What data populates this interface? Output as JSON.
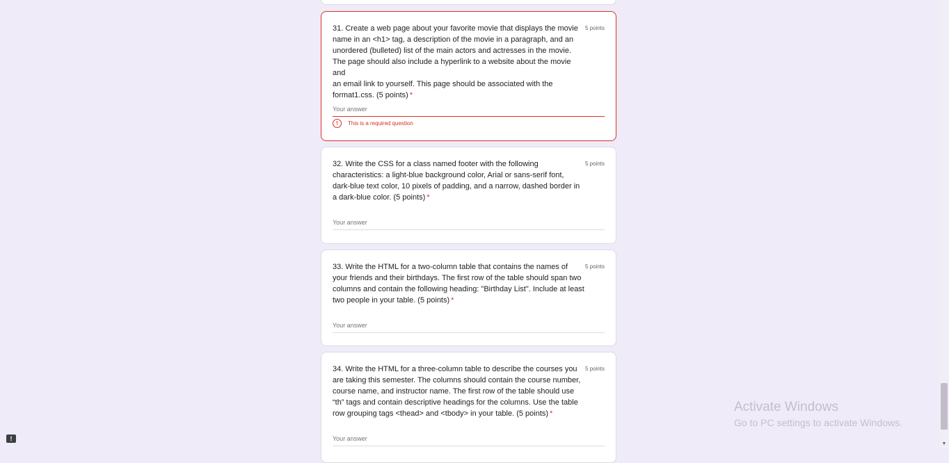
{
  "questions": [
    {
      "text": "31. Create a web page about your favorite movie that displays the movie\nname in an <h1> tag, a description of the movie in a paragraph, and an\nunordered (bulleted) list of the main actors and actresses in the movie.\nThe page should also include a hyperlink to a website about the movie and\nan email link to yourself. This page should be associated with the\nformat1.css. (5 points)",
      "required": "*",
      "points": "5 points",
      "placeholder": "Your answer",
      "error": "This is a required question"
    },
    {
      "text": "32. Write the CSS for a class named footer with the following\ncharacteristics: a light-blue background color, Arial or sans-serif font,\ndark-blue text color, 10 pixels of padding, and a narrow, dashed border in\na dark-blue color. (5 points)",
      "required": "*",
      "points": "5 points",
      "placeholder": "Your answer"
    },
    {
      "text": "33. Write the HTML for a two-column table that contains the names of\nyour friends and their birthdays. The first row of the table should span two\ncolumns and contain the following heading: \"Birthday List\". Include at least\ntwo people in your table. (5 points)",
      "required": "*",
      "points": "5 points",
      "placeholder": "Your answer"
    },
    {
      "text": "34. Write the HTML for a three-column table to describe the courses you\nare taking this semester. The columns should contain the course number,\ncourse name, and instructor name. The first row of the table should use\n“th” tags and contain descriptive headings for the columns. Use the table\nrow grouping tags <thead> and <tbody> in your table. (5 points)",
      "required": "*",
      "points": "5 points",
      "placeholder": "Your answer"
    }
  ],
  "watermark": {
    "title": "Activate Windows",
    "subtitle": "Go to PC settings to activate Windows."
  },
  "icons": {
    "error": "error-icon",
    "feedback": "feedback-icon",
    "scroll_down": "chevron-down-icon"
  },
  "colors": {
    "background": "#f0ebf8",
    "error": "#d93025"
  }
}
